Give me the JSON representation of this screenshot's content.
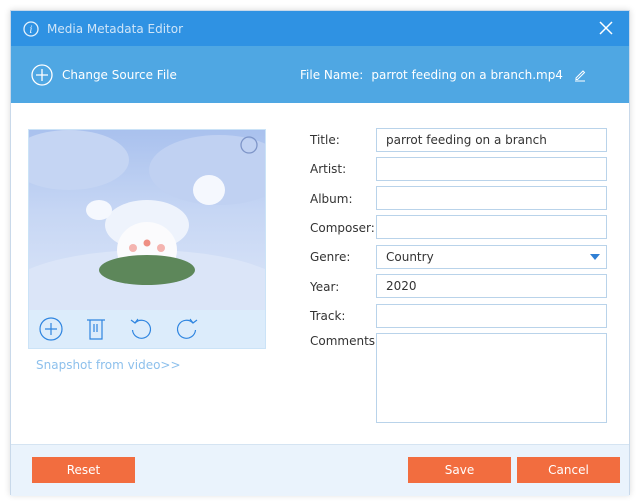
{
  "window": {
    "title": "Media Metadata Editor",
    "icon": "info-icon",
    "close_icon": "close-icon"
  },
  "subheader": {
    "change_source": "Change Source File",
    "file_name_label": "File Name:",
    "file_name": "parrot feeding on a branch.mp4",
    "edit_icon": "pencil-icon"
  },
  "cover": {
    "tools": [
      "add-icon",
      "trash-icon",
      "rotate-left-icon",
      "rotate-right-icon"
    ],
    "snapshot_link": "Snapshot from video>>"
  },
  "form": {
    "title": {
      "label": "Title:",
      "value": "parrot feeding on a branch"
    },
    "artist": {
      "label": "Artist:",
      "value": ""
    },
    "album": {
      "label": "Album:",
      "value": ""
    },
    "composer": {
      "label": "Composer:",
      "value": ""
    },
    "genre": {
      "label": "Genre:",
      "value": "Country"
    },
    "year": {
      "label": "Year:",
      "value": "2020"
    },
    "track": {
      "label": "Track:",
      "value": ""
    },
    "comments": {
      "label": "Comments:",
      "value": ""
    }
  },
  "footer": {
    "reset": "Reset",
    "save": "Save",
    "cancel": "Cancel"
  },
  "colors": {
    "title_bar": "#2f92e3",
    "sub_header": "#4fa7e3",
    "button": "#f26d3f"
  }
}
